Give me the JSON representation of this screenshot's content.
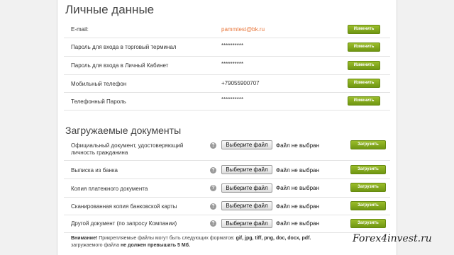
{
  "personal": {
    "title": "Личные данные",
    "rows": [
      {
        "label": "E-mail:",
        "value": "pammtest@bk.ru",
        "button": "Изменить"
      },
      {
        "label": "Пароль для входа в торговый терминал",
        "value": "**********",
        "button": "Изменить"
      },
      {
        "label": "Пароль для входа в Личный Кабинет",
        "value": "**********",
        "button": "Изменить"
      },
      {
        "label": "Мобильный телефон",
        "value": "+79055900707",
        "button": "Изменить"
      },
      {
        "label": "Телефонный Пароль",
        "value": "**********",
        "button": "Изменить"
      }
    ]
  },
  "documents": {
    "title": "Загружаемые документы",
    "choose_label": "Выберите файл",
    "no_file_label": "Файл не выбран",
    "upload_label": "Загрузить",
    "help_glyph": "?",
    "rows": [
      {
        "label": "Официальный документ, удостоверяющий личность гражданина"
      },
      {
        "label": "Выписка из банка"
      },
      {
        "label": "Копия платежного документа"
      },
      {
        "label": "Сканированная копия банковской карты"
      },
      {
        "label": "Другой документ (по запросу Компании)"
      }
    ],
    "notice_prefix": "Внимание!",
    "notice_mid": " Прикрепляемые файлы могут быть следующих форматов: ",
    "notice_formats": "gif, jpg, tiff, png, doc, docx, pdf.",
    "notice_line2": "загружаемого файла ",
    "notice_limit": "не должен превышать 5 Мб."
  },
  "watermark": "Forex4invest.ru",
  "colors": {
    "accent_button": "#7ea41a",
    "email": "#e8763a"
  }
}
